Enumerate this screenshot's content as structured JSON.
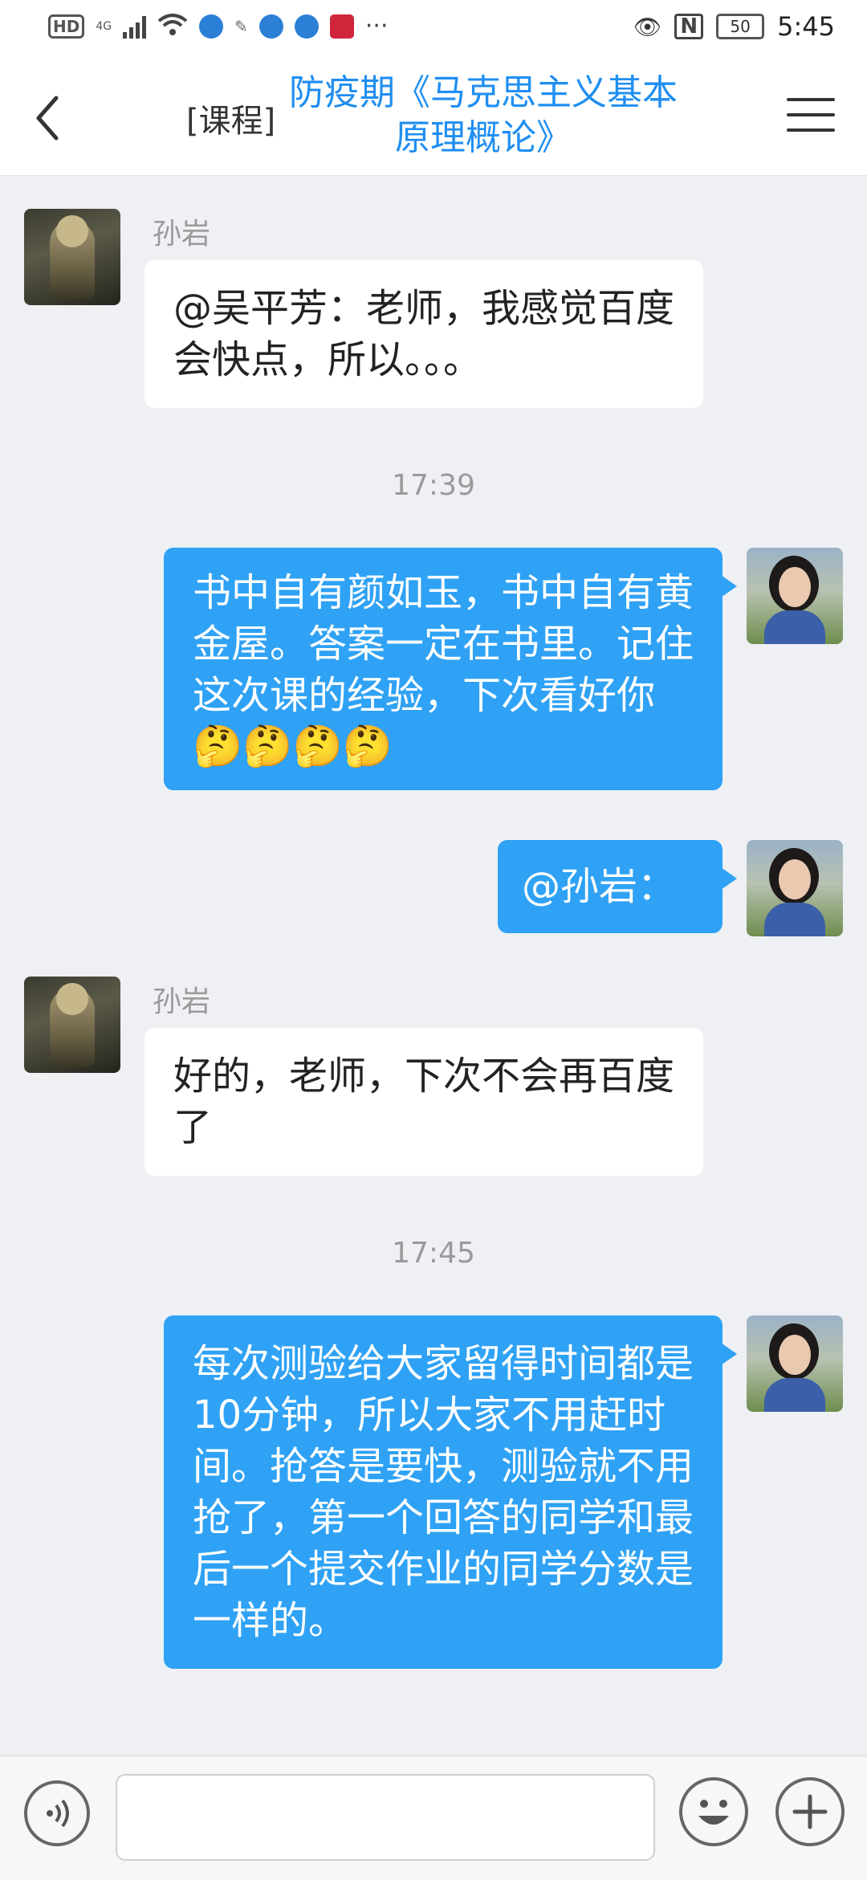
{
  "status_bar": {
    "hd": "HD",
    "signal_type": "4G",
    "battery": "50",
    "time": "5:45"
  },
  "header": {
    "prefix": "[课程]",
    "title": "防疫期《马克思主义基本原理概论》"
  },
  "messages": [
    {
      "side": "left",
      "sender": "孙岩",
      "text": "@吴平芳：老师，我感觉百度会快点，所以。。。"
    },
    {
      "timestamp": "17:39"
    },
    {
      "side": "right",
      "text": "书中自有颜如玉，书中自有黄金屋。答案一定在书里。记住这次课的经验，下次看好你",
      "emoji": "🤔🤔🤔🤔"
    },
    {
      "side": "right",
      "text": "@孙岩："
    },
    {
      "side": "left",
      "sender": "孙岩",
      "text": "好的，老师，下次不会再百度了"
    },
    {
      "timestamp": "17:45"
    },
    {
      "side": "right",
      "text": "每次测验给大家留得时间都是10分钟，所以大家不用赶时间。抢答是要快，测验就不用抢了，第一个回答的同学和最后一个提交作业的同学分数是一样的。"
    }
  ],
  "input_bar": {
    "placeholder": ""
  },
  "icons": {
    "back": "chevron-left-icon",
    "menu": "hamburger-menu-icon",
    "voice": "voice-icon",
    "emoji": "emoji-icon",
    "plus": "plus-icon"
  },
  "colors": {
    "accent": "#1f8ef1",
    "bubble_right": "#2fa2f5",
    "background": "#eef0f4"
  }
}
